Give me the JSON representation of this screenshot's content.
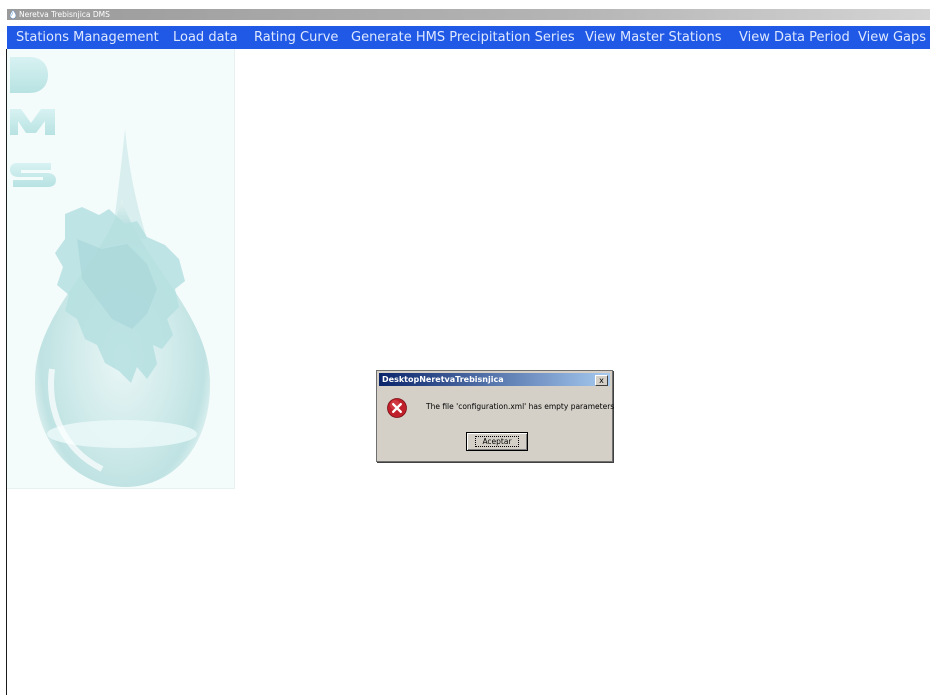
{
  "window": {
    "title": "Neretva Trebisnjica DMS"
  },
  "menu": {
    "items": [
      {
        "name": "menu-stations-management",
        "label": "Stations Management"
      },
      {
        "name": "menu-load-data",
        "label": "Load data"
      },
      {
        "name": "menu-rating-curve",
        "label": "Rating Curve"
      },
      {
        "name": "menu-generate-hms-precipitation-series",
        "label": "Generate HMS Precipitation Series"
      },
      {
        "name": "menu-view-master-stations",
        "label": "View Master Stations"
      },
      {
        "name": "menu-view-data-period",
        "label": "View Data Period"
      },
      {
        "name": "menu-view-gaps",
        "label": "View Gaps"
      }
    ]
  },
  "side_panel": {
    "letters": [
      "D",
      "M",
      "S"
    ]
  },
  "dialog": {
    "title": "DesktopNeretvaTrebisnjica",
    "close_glyph": "x",
    "message": "The file 'configuration.xml' has empty parameters",
    "button_label": "Aceptar",
    "icon": "error-icon"
  }
}
